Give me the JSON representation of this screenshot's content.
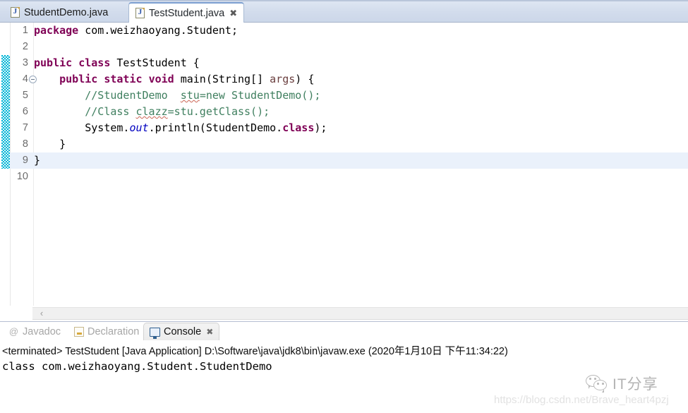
{
  "app": {
    "name": "Eclipse IDE"
  },
  "editor": {
    "tabs": [
      {
        "label": "StudentDemo.java",
        "icon": "java-file-icon",
        "active": false,
        "closable": false
      },
      {
        "label": "TestStudent.java",
        "icon": "java-file-icon",
        "active": true,
        "closable": true,
        "close_glyph": "✖"
      }
    ],
    "current_line": 9,
    "change_bar_lines": [
      3,
      9
    ],
    "scrollbar": {
      "left_arrow_glyph": "‹"
    },
    "lines": [
      {
        "number": "1",
        "fold": false,
        "tokens": [
          {
            "text": "package",
            "type": "keyword"
          },
          {
            "text": " com.weizhaoyang.Student;",
            "type": "plain"
          }
        ]
      },
      {
        "number": "2",
        "fold": false,
        "tokens": []
      },
      {
        "number": "3",
        "fold": false,
        "tokens": [
          {
            "text": "public",
            "type": "keyword"
          },
          {
            "text": " ",
            "type": "plain"
          },
          {
            "text": "class",
            "type": "keyword"
          },
          {
            "text": " TestStudent {",
            "type": "plain"
          }
        ]
      },
      {
        "number": "4",
        "fold": true,
        "tokens": [
          {
            "text": "    ",
            "type": "plain"
          },
          {
            "text": "public",
            "type": "keyword"
          },
          {
            "text": " ",
            "type": "plain"
          },
          {
            "text": "static",
            "type": "keyword"
          },
          {
            "text": " ",
            "type": "plain"
          },
          {
            "text": "void",
            "type": "keyword"
          },
          {
            "text": " main(String[] ",
            "type": "plain"
          },
          {
            "text": "args",
            "type": "param"
          },
          {
            "text": ") {",
            "type": "plain"
          }
        ]
      },
      {
        "number": "5",
        "fold": false,
        "tokens": [
          {
            "text": "        //StudentDemo  ",
            "type": "comment"
          },
          {
            "text": "stu",
            "type": "comment-squiggle"
          },
          {
            "text": "=new StudentDemo();",
            "type": "comment"
          }
        ]
      },
      {
        "number": "6",
        "fold": false,
        "tokens": [
          {
            "text": "        //Class ",
            "type": "comment"
          },
          {
            "text": "clazz",
            "type": "comment-squiggle"
          },
          {
            "text": "=stu.getClass();",
            "type": "comment"
          }
        ]
      },
      {
        "number": "7",
        "fold": false,
        "tokens": [
          {
            "text": "        System.",
            "type": "plain"
          },
          {
            "text": "out",
            "type": "field"
          },
          {
            "text": ".println(StudentDemo.",
            "type": "plain"
          },
          {
            "text": "class",
            "type": "keyword"
          },
          {
            "text": ");",
            "type": "plain"
          }
        ]
      },
      {
        "number": "8",
        "fold": false,
        "tokens": [
          {
            "text": "    }",
            "type": "plain"
          }
        ]
      },
      {
        "number": "9",
        "fold": false,
        "tokens": [
          {
            "text": "}",
            "type": "plain"
          }
        ]
      },
      {
        "number": "10",
        "fold": false,
        "tokens": []
      }
    ]
  },
  "bottom_panel": {
    "tabs": [
      {
        "label": "Javadoc",
        "icon": "at-icon",
        "active": false,
        "closable": false
      },
      {
        "label": "Declaration",
        "icon": "declaration-icon",
        "active": false,
        "closable": false
      },
      {
        "label": "Console",
        "icon": "console-icon",
        "active": true,
        "closable": true,
        "close_glyph": "✖"
      }
    ],
    "console": {
      "header": "<terminated> TestStudent [Java Application] D:\\Software\\java\\jdk8\\bin\\javaw.exe (2020年1月10日 下午11:34:22)",
      "output": "class com.weizhaoyang.Student.StudentDemo"
    }
  },
  "watermark": {
    "brand": "IT分享",
    "url": "https://blog.csdn.net/Brave_heart4pzj"
  },
  "colors": {
    "keyword": "#7f0055",
    "comment": "#3f7f5f",
    "field": "#0000c0",
    "param": "#6a3e3e",
    "change_bar": "#00b5d6",
    "current_line_bg": "#eaf1fb",
    "tab_bar_bg": "#d2dcec"
  }
}
